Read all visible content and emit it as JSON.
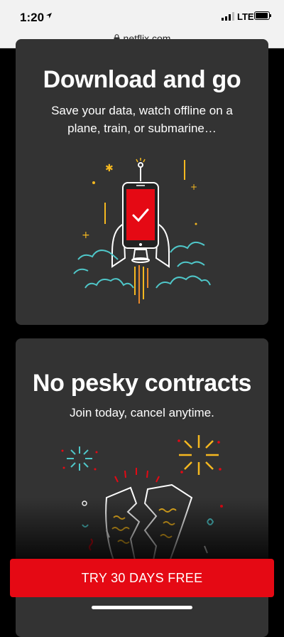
{
  "status_bar": {
    "time": "1:20",
    "network": "LTE"
  },
  "browser": {
    "url": "netflix.com"
  },
  "cards": [
    {
      "title": "Download and go",
      "subtitle": "Save your data, watch offline on a plane, train, or submarine…"
    },
    {
      "title": "No pesky contracts",
      "subtitle": "Join today, cancel anytime."
    }
  ],
  "cta": {
    "label": "TRY 30 DAYS FREE"
  },
  "colors": {
    "brand_red": "#e50914",
    "card_bg": "#333333",
    "accent_yellow": "#f5b820",
    "accent_teal": "#4fc7c9"
  },
  "icons": [
    "location-arrow-icon",
    "lock-icon",
    "rocket-phone-illustration",
    "torn-contract-illustration"
  ]
}
